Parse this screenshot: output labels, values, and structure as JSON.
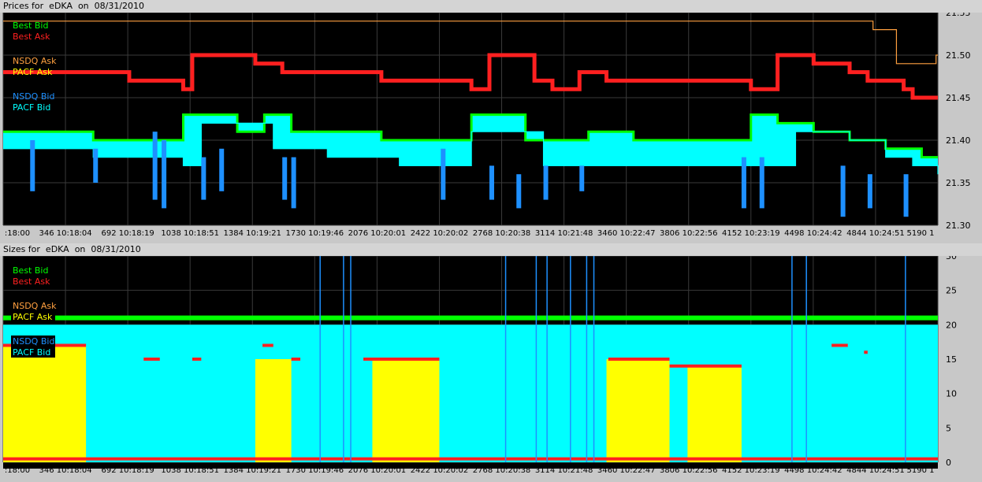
{
  "charts": {
    "prices_title": "Prices for  eDKA  on  08/31/2010",
    "sizes_title": "Sizes for  eDKA  on  08/31/2010"
  },
  "legend": [
    {
      "name": "Best Bid",
      "color": "#00ff00"
    },
    {
      "name": "Best Ask",
      "color": "#ff2020"
    },
    {
      "name": "NSDQ Ask",
      "color": "#ffa040"
    },
    {
      "name": "PACF Ask",
      "color": "#ffff00"
    },
    {
      "name": "NSDQ Bid",
      "color": "#1e90ff"
    },
    {
      "name": "PACF Bid",
      "color": "#00ffff"
    }
  ],
  "colors": {
    "plot_bg": "#000000",
    "frame_bg": "#c8c8c8",
    "grid": "#3a3a3a"
  },
  "chart_data": [
    {
      "type": "line",
      "title": "Prices for  eDKA  on  08/31/2010",
      "x_ticks": [
        ":18:00",
        "346 10:18:04",
        "692 10:18:19",
        "1038 10:18:51",
        "1384 10:19:21",
        "1730 10:19:46",
        "2076 10:20:01",
        "2422 10:20:02",
        "2768 10:20:38",
        "3114 10:21:48",
        "3460 10:22:47",
        "3806 10:22:56",
        "4152 10:23:19",
        "4498 10:24:42",
        "4844 10:24:51",
        "5190 1"
      ],
      "y_ticks": [
        "21.55",
        "21.50",
        "21.45",
        "21.40",
        "21.35",
        "21.30"
      ],
      "ylim": [
        21.3,
        21.55
      ],
      "xlim": [
        0,
        5190
      ],
      "series": [
        {
          "name": "NSDQ Ask",
          "x": [
            0,
            4800,
            4830,
            4950,
            4960,
            5170,
            5180,
            5190
          ],
          "y": [
            21.54,
            21.54,
            21.53,
            21.53,
            21.49,
            21.49,
            21.5,
            21.5
          ]
        },
        {
          "name": "Best Ask",
          "x": [
            0,
            500,
            700,
            900,
            1000,
            1050,
            1300,
            1400,
            1550,
            1750,
            2100,
            2422,
            2600,
            2700,
            2800,
            2950,
            3050,
            3200,
            3350,
            3600,
            4000,
            4152,
            4300,
            4500,
            4700,
            4800,
            5000,
            5050,
            5190
          ],
          "y": [
            21.48,
            21.48,
            21.47,
            21.47,
            21.46,
            21.5,
            21.5,
            21.49,
            21.48,
            21.48,
            21.47,
            21.47,
            21.46,
            21.5,
            21.5,
            21.47,
            21.46,
            21.48,
            21.47,
            21.47,
            21.47,
            21.46,
            21.5,
            21.49,
            21.48,
            21.47,
            21.46,
            21.45,
            21.45
          ]
        },
        {
          "name": "Best Bid",
          "x": [
            0,
            250,
            500,
            700,
            900,
            1000,
            1100,
            1300,
            1450,
            1600,
            1800,
            2100,
            2422,
            2600,
            2700,
            2900,
            3100,
            3250,
            3500,
            3800,
            4000,
            4152,
            4300,
            4500,
            4700,
            4900,
            5100,
            5190
          ],
          "y": [
            21.41,
            21.41,
            21.4,
            21.4,
            21.4,
            21.43,
            21.43,
            21.41,
            21.43,
            21.41,
            21.41,
            21.4,
            21.4,
            21.43,
            21.43,
            21.4,
            21.4,
            21.41,
            21.4,
            21.4,
            21.4,
            21.43,
            21.42,
            21.41,
            21.4,
            21.39,
            21.38,
            21.38
          ]
        },
        {
          "name": "PACF Bid",
          "x": [
            0,
            300,
            500,
            800,
            1000,
            1100,
            1300,
            1500,
            1800,
            2200,
            2422,
            2600,
            2800,
            3000,
            3300,
            3600,
            3800,
            4000,
            4152,
            4400,
            4700,
            4900,
            5050,
            5190
          ],
          "y": [
            21.39,
            21.39,
            21.38,
            21.38,
            21.37,
            21.42,
            21.42,
            21.39,
            21.38,
            21.37,
            21.37,
            21.41,
            21.41,
            21.37,
            21.37,
            21.37,
            21.37,
            21.37,
            21.37,
            21.41,
            21.4,
            21.38,
            21.37,
            21.36
          ]
        }
      ]
    },
    {
      "type": "area",
      "title": "Sizes for  eDKA  on  08/31/2010",
      "x_ticks": [
        ":18:00",
        "346 10:18:04",
        "692 10:18:19",
        "1038 10:18:51",
        "1384 10:19:21",
        "1730 10:19:46",
        "2076 10:20:01",
        "2422 10:20:02",
        "2768 10:20:38",
        "3114 10:21:48",
        "3460 10:22:47",
        "3806 10:22:56",
        "4152 10:23:19",
        "4498 10:24:42",
        "4844 10:24:51",
        "5190 1"
      ],
      "y_ticks": [
        "30",
        "25",
        "20",
        "15",
        "10",
        "5",
        "0"
      ],
      "ylim": [
        0,
        30
      ],
      "xlim": [
        0,
        5190
      ],
      "series": [
        {
          "name": "Best Bid",
          "x": [
            0,
            5190
          ],
          "y": [
            21,
            21
          ]
        },
        {
          "name": "PACF Bid",
          "x": [
            0,
            5190
          ],
          "y": [
            20,
            20
          ]
        },
        {
          "name": "PACF Ask",
          "segments": [
            [
              0,
              460,
              17
            ],
            [
              1400,
              1600,
              15
            ],
            [
              2050,
              2422,
              15
            ],
            [
              3350,
              3700,
              15
            ],
            [
              3800,
              4100,
              14
            ]
          ]
        },
        {
          "name": "Best Ask",
          "segments": [
            [
              0,
              460,
              17
            ],
            [
              780,
              870,
              15
            ],
            [
              1050,
              1100,
              15
            ],
            [
              1440,
              1500,
              17
            ],
            [
              1600,
              1650,
              15
            ],
            [
              2000,
              2422,
              15
            ],
            [
              3360,
              3700,
              15
            ],
            [
              3700,
              4100,
              14
            ],
            [
              4600,
              4690,
              17
            ],
            [
              4780,
              4800,
              16
            ]
          ]
        }
      ]
    }
  ]
}
